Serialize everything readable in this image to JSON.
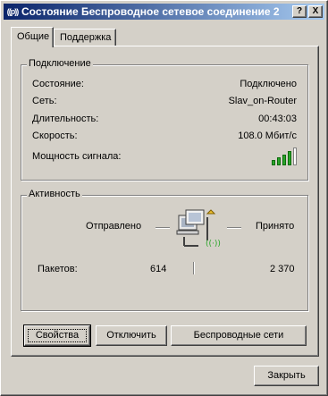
{
  "window": {
    "title": "Состояние Беспроводное сетевое соединение 2",
    "title_icon": "((p))",
    "help_button": "?",
    "close_button": "X"
  },
  "tabs": [
    {
      "label": "Общие",
      "active": true
    },
    {
      "label": "Поддержка",
      "active": false
    }
  ],
  "connection": {
    "group_label": "Подключение",
    "rows": [
      {
        "key": "Состояние:",
        "value": "Подключено"
      },
      {
        "key": "Сеть:",
        "value": "Slav_on-Router"
      },
      {
        "key": "Длительность:",
        "value": "00:43:03"
      },
      {
        "key": "Скорость:",
        "value": "108.0 Мбит/с"
      }
    ],
    "signal_label": "Мощность сигнала:",
    "signal_icon": "signal-strength-icon",
    "signal_bars": 5,
    "signal_color": "#2aa52a"
  },
  "activity": {
    "group_label": "Активность",
    "sent_label": "Отправлено",
    "received_label": "Принято",
    "packets_label": "Пакетов:",
    "packets_sent": "614",
    "packets_received": "2 370",
    "icon": "network-computers-icon"
  },
  "buttons": {
    "properties_label": "Свойства",
    "disconnect_label": "Отключить",
    "wireless_label": "Беспроводные сети",
    "close_label": "Закрыть"
  }
}
